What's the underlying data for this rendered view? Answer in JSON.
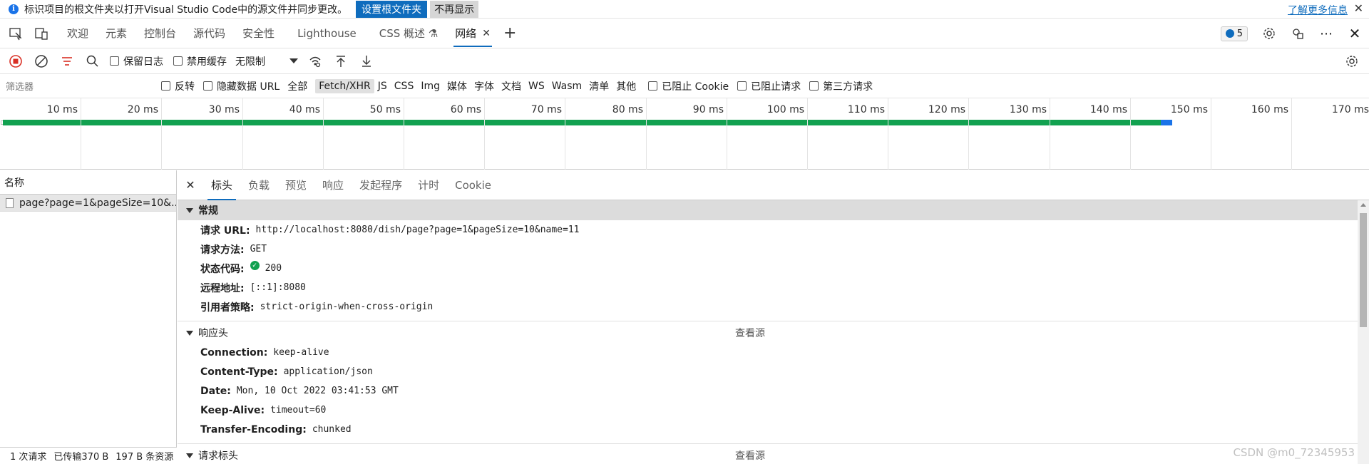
{
  "infobar": {
    "message": "标识项目的根文件夹以打开Visual Studio Code中的源文件并同步更改。",
    "primary_button": "设置根文件夹",
    "secondary_button": "不再显示",
    "learn_more": "了解更多信息",
    "close": "✕"
  },
  "devtools_tabs": [
    {
      "label": "欢迎"
    },
    {
      "label": "元素"
    },
    {
      "label": "控制台"
    },
    {
      "label": "源代码"
    },
    {
      "label": "安全性"
    },
    {
      "label": "Lighthouse"
    },
    {
      "label": "CSS 概述 ⚗"
    },
    {
      "label": "网络",
      "active": true,
      "close": "✕"
    }
  ],
  "messages_badge": "5",
  "toolbar": {
    "preserve_log": "保留日志",
    "disable_cache": "禁用缓存",
    "throttle": "无限制"
  },
  "filter": {
    "placeholder": "筛选器",
    "invert": "反转",
    "hide_data_urls": "隐藏数据 URL",
    "types": [
      "全部",
      "Fetch/XHR",
      "JS",
      "CSS",
      "Img",
      "媒体",
      "字体",
      "文档",
      "WS",
      "Wasm",
      "清单",
      "其他"
    ],
    "active_type": "Fetch/XHR",
    "blocked_cookies": "已阻止 Cookie",
    "blocked_requests": "已阻止请求",
    "third_party": "第三方请求"
  },
  "timeline": {
    "ticks": [
      "10 ms",
      "20 ms",
      "30 ms",
      "40 ms",
      "50 ms",
      "60 ms",
      "70 ms",
      "80 ms",
      "90 ms",
      "100 ms",
      "110 ms",
      "120 ms",
      "130 ms",
      "140 ms",
      "150 ms",
      "160 ms",
      "170 ms"
    ]
  },
  "request_list": {
    "header": "名称",
    "rows": [
      "page?page=1&pageSize=10&..."
    ],
    "status": [
      "1 次请求",
      "已传输370 B",
      "197 B 条资源"
    ]
  },
  "detail_tabs": {
    "close": "✕",
    "tabs": [
      "标头",
      "负载",
      "预览",
      "响应",
      "发起程序",
      "计时",
      "Cookie"
    ],
    "active": "标头"
  },
  "general": {
    "title": "常规",
    "rows": [
      {
        "k": "请求 URL:",
        "v": "http://localhost:8080/dish/page?page=1&pageSize=10&name=11"
      },
      {
        "k": "请求方法:",
        "v": "GET"
      },
      {
        "k": "状态代码:",
        "v": "200"
      },
      {
        "k": "远程地址:",
        "v": "[::1]:8080"
      },
      {
        "k": "引用者策略:",
        "v": "strict-origin-when-cross-origin"
      }
    ]
  },
  "response_headers": {
    "title": "响应头",
    "view_source": "查看源",
    "rows": [
      {
        "k": "Connection:",
        "v": "keep-alive"
      },
      {
        "k": "Content-Type:",
        "v": "application/json"
      },
      {
        "k": "Date:",
        "v": "Mon, 10 Oct 2022 03:41:53 GMT"
      },
      {
        "k": "Keep-Alive:",
        "v": "timeout=60"
      },
      {
        "k": "Transfer-Encoding:",
        "v": "chunked"
      }
    ]
  },
  "request_headers": {
    "title": "请求标头",
    "view_source": "查看源"
  },
  "watermark": "CSDN @m0_72345953",
  "colors": {
    "accent": "#0f6cbd",
    "success": "#12a150",
    "record": "#d93025"
  }
}
